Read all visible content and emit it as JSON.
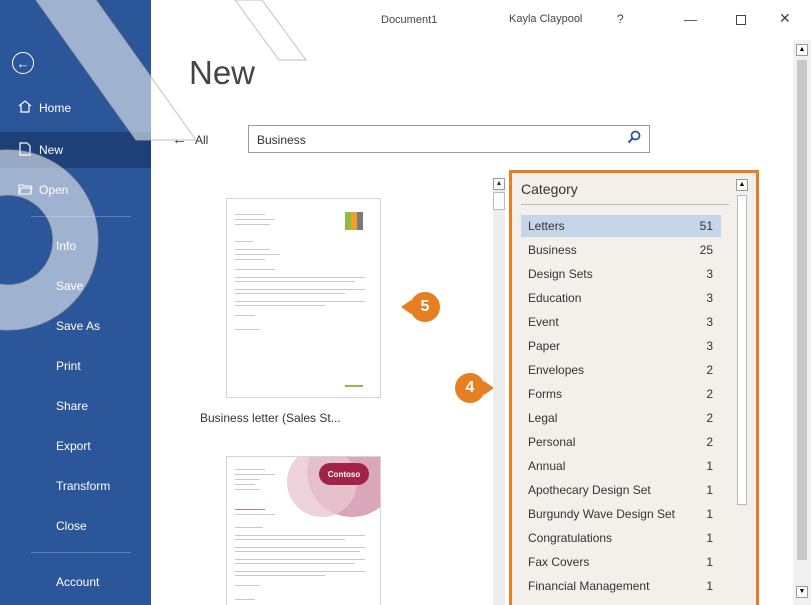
{
  "titlebar": {
    "document_title": "Document1",
    "user_name": "Kayla Claypool",
    "help": "?",
    "minimize": "—",
    "close": "✕"
  },
  "sidebar": {
    "back": "←",
    "items": [
      {
        "label": "Home",
        "icon": "home-icon"
      },
      {
        "label": "New",
        "icon": "new-document-icon"
      },
      {
        "label": "Open",
        "icon": "folder-icon"
      },
      {
        "label": "Info"
      },
      {
        "label": "Save"
      },
      {
        "label": "Save As"
      },
      {
        "label": "Print"
      },
      {
        "label": "Share"
      },
      {
        "label": "Export"
      },
      {
        "label": "Transform"
      },
      {
        "label": "Close"
      },
      {
        "label": "Account"
      }
    ]
  },
  "main": {
    "heading": "New",
    "all_label": "All",
    "search_value": "Business",
    "template_label": "Business letter (Sales St..."
  },
  "callouts": {
    "five": "5",
    "four": "4"
  },
  "category": {
    "header": "Category",
    "rows": [
      {
        "name": "Letters",
        "count": "51"
      },
      {
        "name": "Business",
        "count": "25"
      },
      {
        "name": "Design Sets",
        "count": "3"
      },
      {
        "name": "Education",
        "count": "3"
      },
      {
        "name": "Event",
        "count": "3"
      },
      {
        "name": "Paper",
        "count": "3"
      },
      {
        "name": "Envelopes",
        "count": "2"
      },
      {
        "name": "Forms",
        "count": "2"
      },
      {
        "name": "Legal",
        "count": "2"
      },
      {
        "name": "Personal",
        "count": "2"
      },
      {
        "name": "Annual",
        "count": "1"
      },
      {
        "name": "Apothecary Design Set",
        "count": "1"
      },
      {
        "name": "Burgundy Wave Design Set",
        "count": "1"
      },
      {
        "name": "Congratulations",
        "count": "1"
      },
      {
        "name": "Fax Covers",
        "count": "1"
      },
      {
        "name": "Financial Management",
        "count": "1"
      }
    ]
  },
  "template2": {
    "logo_text": "Contoso"
  },
  "colors": {
    "sidebar": "#2b579a",
    "sidebar_active": "#1e4079",
    "accent": "#e67e22",
    "selected_row": "#c7d5ea"
  }
}
